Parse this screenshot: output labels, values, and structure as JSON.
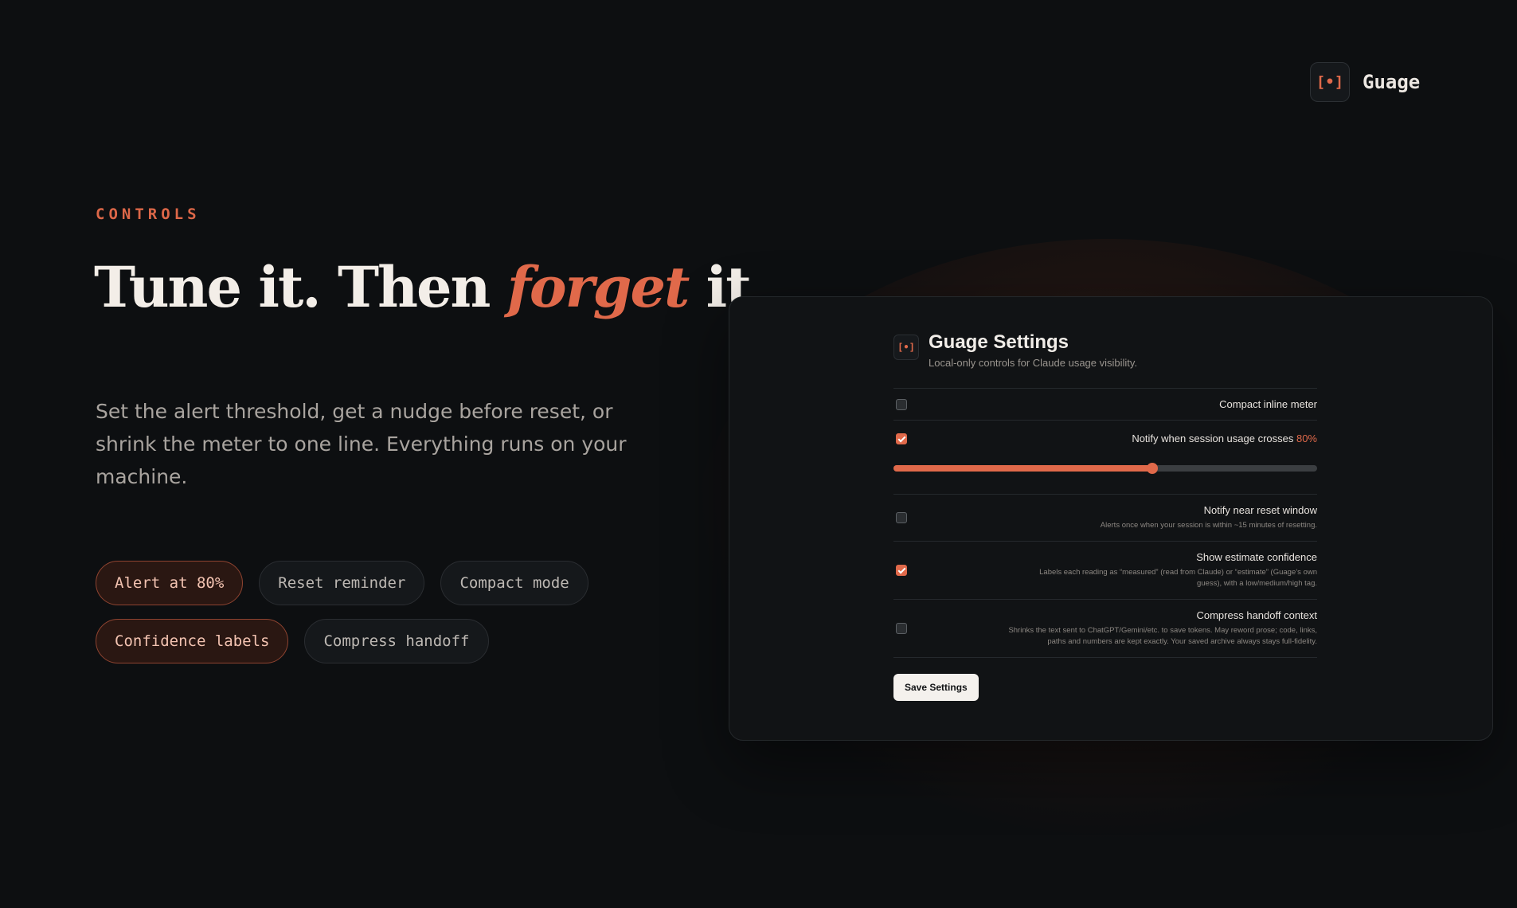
{
  "brand": {
    "logo_glyph": "[•]",
    "logo_icon": "bracket-dot-icon",
    "name": "Guage"
  },
  "hero": {
    "eyebrow": "CONTROLS",
    "headline_before": "Tune it. Then ",
    "headline_accent": "forget",
    "headline_after": " it.",
    "lede": "Set the alert threshold, get a nudge before reset, or shrink the meter to one line. Everything runs on your machine."
  },
  "chips": [
    {
      "label": "Alert at 80%",
      "active": true
    },
    {
      "label": "Reset reminder",
      "active": false
    },
    {
      "label": "Compact mode",
      "active": false
    },
    {
      "label": "Confidence labels",
      "active": true
    },
    {
      "label": "Compress handoff",
      "active": false
    }
  ],
  "settings": {
    "logo_glyph": "[•]",
    "title": "Guage Settings",
    "subtitle": "Local-only controls for Claude usage visibility.",
    "compact": {
      "label": "Compact inline meter",
      "checked": false
    },
    "notify": {
      "label_prefix": "Notify when session usage crosses ",
      "threshold_text": "80%",
      "checked": true,
      "slider_fraction": 0.61
    },
    "reset": {
      "label": "Notify near reset window",
      "desc": "Alerts once when your session is within ~15 minutes of resetting.",
      "checked": false
    },
    "confidence": {
      "label": "Show estimate confidence",
      "desc": "Labels each reading as “measured” (read from Claude) or “estimate” (Guage’s own guess), with a low/medium/high tag.",
      "checked": true
    },
    "compress": {
      "label": "Compress handoff context",
      "desc": "Shrinks the text sent to ChatGPT/Gemini/etc. to save tokens. May reword prose; code, links, paths and numbers are kept exactly. Your saved archive always stays full-fidelity.",
      "checked": false
    },
    "save_label": "Save Settings"
  },
  "colors": {
    "accent": "#e0694a",
    "background": "#0d0f11",
    "panel": "#111315"
  }
}
